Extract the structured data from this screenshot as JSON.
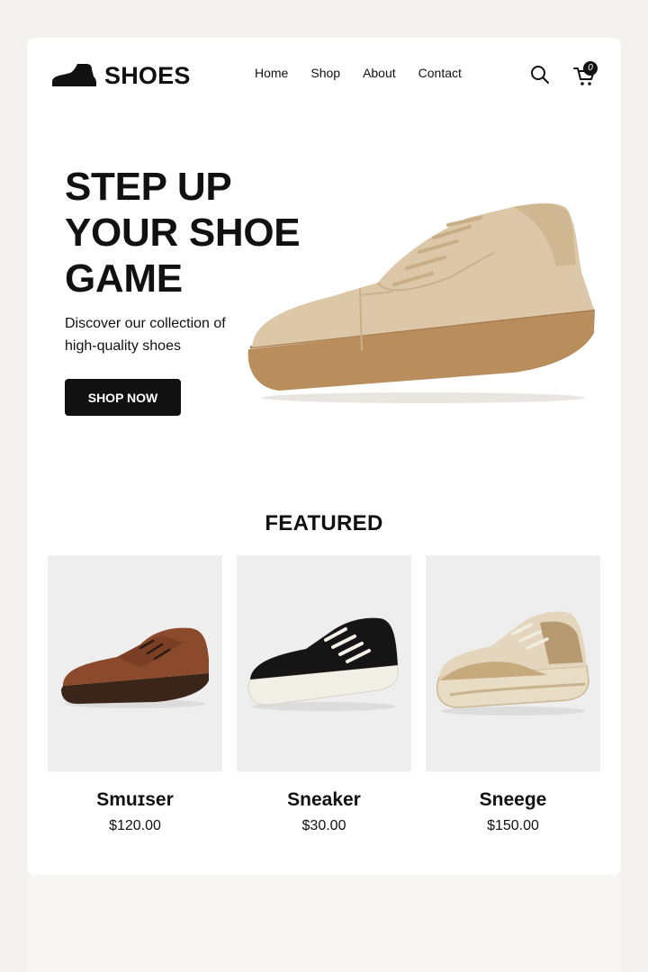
{
  "header": {
    "logo_text": "SHOES",
    "nav": [
      "Home",
      "Shop",
      "About",
      "Contact"
    ],
    "cart_count": "0"
  },
  "hero": {
    "title_lines": [
      "STEP UP",
      "YOUR SHOE",
      "GAME"
    ],
    "subtitle_lines": [
      "Discover our collection of",
      "high-quality shoes"
    ],
    "cta_label": "SHOP NOW",
    "image_icon": "beige-sneaker-image"
  },
  "featured": {
    "title": "FEATURED",
    "products": [
      {
        "name": "Smuɪser",
        "price": "$120.00",
        "image_icon": "brown-oxford-shoe-image"
      },
      {
        "name": "Sneaker",
        "price": "$30.00",
        "image_icon": "black-sneaker-image"
      },
      {
        "name": "Sneege",
        "price": "$150.00",
        "image_icon": "beige-chunky-sneaker-image"
      }
    ]
  },
  "colors": {
    "page_bg": "#f3f2ef",
    "card_bg": "#ffffff",
    "accent": "#111111",
    "product_bg": "#eeeeee",
    "suede": "#dcc7a8",
    "gum_sole": "#b98d5c"
  }
}
